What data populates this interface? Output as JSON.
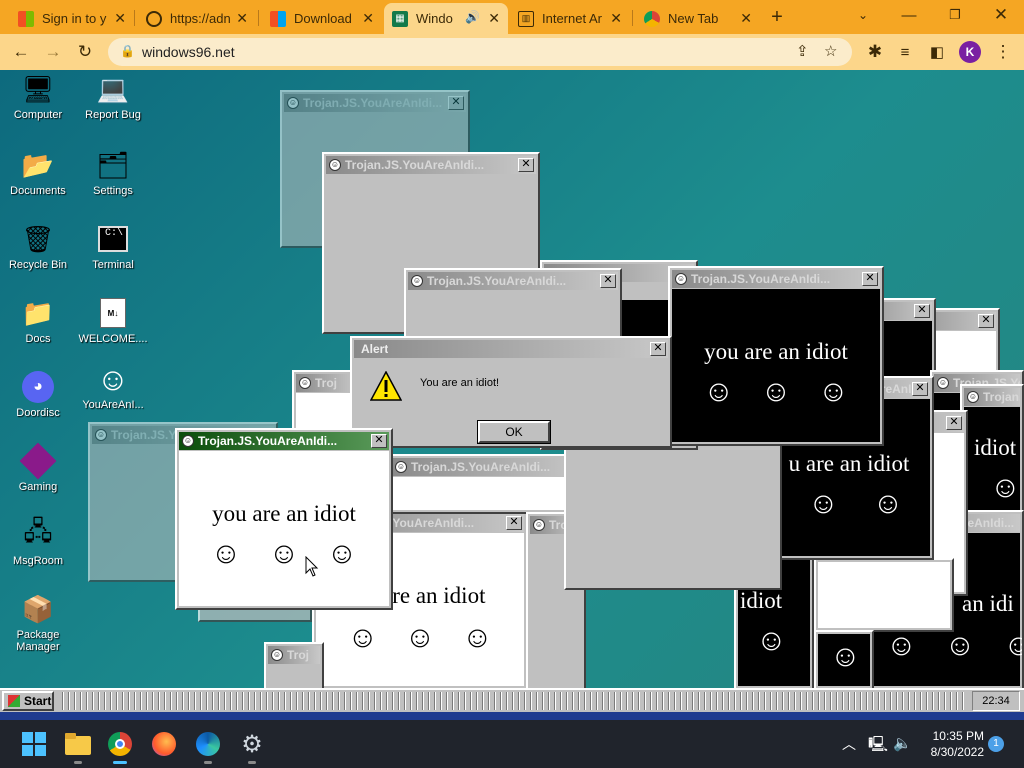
{
  "browser": {
    "tabs": [
      {
        "title": "Sign in to y",
        "icon": "microsoft-logo-icon"
      },
      {
        "title": "https://adn",
        "icon": "globe-icon"
      },
      {
        "title": "Download",
        "icon": "microsoft-logo-icon"
      },
      {
        "title": "Windo",
        "icon": "windows96-icon",
        "active": true,
        "audio": true
      },
      {
        "title": "Internet Ar",
        "icon": "archive-icon"
      },
      {
        "title": "New Tab",
        "icon": "chrome-icon"
      }
    ],
    "url": "windows96.net",
    "profile_initial": "K"
  },
  "desktop": {
    "icons": [
      {
        "label": "Computer",
        "icon": "computer-icon"
      },
      {
        "label": "Report Bug",
        "icon": "report-bug-icon"
      },
      {
        "label": "Documents",
        "icon": "documents-icon"
      },
      {
        "label": "Settings",
        "icon": "settings-icon"
      },
      {
        "label": "Recycle Bin",
        "icon": "recycle-bin-icon"
      },
      {
        "label": "Terminal",
        "icon": "terminal-icon"
      },
      {
        "label": "Docs",
        "icon": "folder-icon"
      },
      {
        "label": "WELCOME....",
        "icon": "markdown-file-icon"
      },
      {
        "label": "Doordisc",
        "icon": "discord-icon"
      },
      {
        "label": "YouAreAnI...",
        "icon": "smiley-icon"
      },
      {
        "label": "Gaming",
        "icon": "cube-icon"
      },
      {
        "label": "MsgRoom",
        "icon": "msgroom-icon"
      },
      {
        "label": "Package\nManager",
        "icon": "package-icon"
      }
    ]
  },
  "windows": {
    "title": "Trojan.JS.YouAreAnIdi...",
    "title_short": "Troj",
    "close_glyph": "✕",
    "main_text": "you are an idiot",
    "text_partial_1": "u are an idiot",
    "text_partial_2": "are an idiot",
    "text_partial_3": "idiot",
    "text_partial_4": "an idi",
    "smiley": "☺"
  },
  "alert": {
    "title": "Alert",
    "message": "You are an idiot!",
    "ok_label": "OK"
  },
  "w96_taskbar": {
    "start_label": "Start",
    "clock": "22:34"
  },
  "os_taskbar": {
    "time": "10:35 PM",
    "date": "8/30/2022",
    "notification_count": "1"
  }
}
